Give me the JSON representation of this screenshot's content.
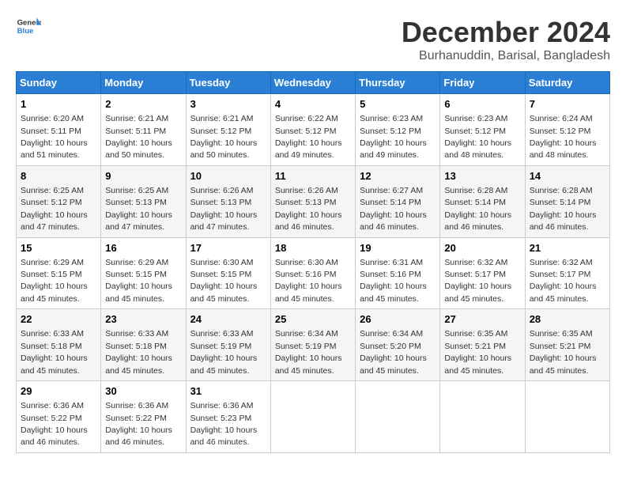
{
  "logo": {
    "line1": "General",
    "line2": "Blue"
  },
  "title": "December 2024",
  "subtitle": "Burhanuddin, Barisal, Bangladesh",
  "weekdays": [
    "Sunday",
    "Monday",
    "Tuesday",
    "Wednesday",
    "Thursday",
    "Friday",
    "Saturday"
  ],
  "weeks": [
    [
      {
        "day": "1",
        "sunrise": "6:20 AM",
        "sunset": "5:11 PM",
        "daylight": "10 hours and 51 minutes."
      },
      {
        "day": "2",
        "sunrise": "6:21 AM",
        "sunset": "5:11 PM",
        "daylight": "10 hours and 50 minutes."
      },
      {
        "day": "3",
        "sunrise": "6:21 AM",
        "sunset": "5:12 PM",
        "daylight": "10 hours and 50 minutes."
      },
      {
        "day": "4",
        "sunrise": "6:22 AM",
        "sunset": "5:12 PM",
        "daylight": "10 hours and 49 minutes."
      },
      {
        "day": "5",
        "sunrise": "6:23 AM",
        "sunset": "5:12 PM",
        "daylight": "10 hours and 49 minutes."
      },
      {
        "day": "6",
        "sunrise": "6:23 AM",
        "sunset": "5:12 PM",
        "daylight": "10 hours and 48 minutes."
      },
      {
        "day": "7",
        "sunrise": "6:24 AM",
        "sunset": "5:12 PM",
        "daylight": "10 hours and 48 minutes."
      }
    ],
    [
      {
        "day": "8",
        "sunrise": "6:25 AM",
        "sunset": "5:12 PM",
        "daylight": "10 hours and 47 minutes."
      },
      {
        "day": "9",
        "sunrise": "6:25 AM",
        "sunset": "5:13 PM",
        "daylight": "10 hours and 47 minutes."
      },
      {
        "day": "10",
        "sunrise": "6:26 AM",
        "sunset": "5:13 PM",
        "daylight": "10 hours and 47 minutes."
      },
      {
        "day": "11",
        "sunrise": "6:26 AM",
        "sunset": "5:13 PM",
        "daylight": "10 hours and 46 minutes."
      },
      {
        "day": "12",
        "sunrise": "6:27 AM",
        "sunset": "5:14 PM",
        "daylight": "10 hours and 46 minutes."
      },
      {
        "day": "13",
        "sunrise": "6:28 AM",
        "sunset": "5:14 PM",
        "daylight": "10 hours and 46 minutes."
      },
      {
        "day": "14",
        "sunrise": "6:28 AM",
        "sunset": "5:14 PM",
        "daylight": "10 hours and 46 minutes."
      }
    ],
    [
      {
        "day": "15",
        "sunrise": "6:29 AM",
        "sunset": "5:15 PM",
        "daylight": "10 hours and 45 minutes."
      },
      {
        "day": "16",
        "sunrise": "6:29 AM",
        "sunset": "5:15 PM",
        "daylight": "10 hours and 45 minutes."
      },
      {
        "day": "17",
        "sunrise": "6:30 AM",
        "sunset": "5:15 PM",
        "daylight": "10 hours and 45 minutes."
      },
      {
        "day": "18",
        "sunrise": "6:30 AM",
        "sunset": "5:16 PM",
        "daylight": "10 hours and 45 minutes."
      },
      {
        "day": "19",
        "sunrise": "6:31 AM",
        "sunset": "5:16 PM",
        "daylight": "10 hours and 45 minutes."
      },
      {
        "day": "20",
        "sunrise": "6:32 AM",
        "sunset": "5:17 PM",
        "daylight": "10 hours and 45 minutes."
      },
      {
        "day": "21",
        "sunrise": "6:32 AM",
        "sunset": "5:17 PM",
        "daylight": "10 hours and 45 minutes."
      }
    ],
    [
      {
        "day": "22",
        "sunrise": "6:33 AM",
        "sunset": "5:18 PM",
        "daylight": "10 hours and 45 minutes."
      },
      {
        "day": "23",
        "sunrise": "6:33 AM",
        "sunset": "5:18 PM",
        "daylight": "10 hours and 45 minutes."
      },
      {
        "day": "24",
        "sunrise": "6:33 AM",
        "sunset": "5:19 PM",
        "daylight": "10 hours and 45 minutes."
      },
      {
        "day": "25",
        "sunrise": "6:34 AM",
        "sunset": "5:19 PM",
        "daylight": "10 hours and 45 minutes."
      },
      {
        "day": "26",
        "sunrise": "6:34 AM",
        "sunset": "5:20 PM",
        "daylight": "10 hours and 45 minutes."
      },
      {
        "day": "27",
        "sunrise": "6:35 AM",
        "sunset": "5:21 PM",
        "daylight": "10 hours and 45 minutes."
      },
      {
        "day": "28",
        "sunrise": "6:35 AM",
        "sunset": "5:21 PM",
        "daylight": "10 hours and 45 minutes."
      }
    ],
    [
      {
        "day": "29",
        "sunrise": "6:36 AM",
        "sunset": "5:22 PM",
        "daylight": "10 hours and 46 minutes."
      },
      {
        "day": "30",
        "sunrise": "6:36 AM",
        "sunset": "5:22 PM",
        "daylight": "10 hours and 46 minutes."
      },
      {
        "day": "31",
        "sunrise": "6:36 AM",
        "sunset": "5:23 PM",
        "daylight": "10 hours and 46 minutes."
      },
      null,
      null,
      null,
      null
    ]
  ]
}
